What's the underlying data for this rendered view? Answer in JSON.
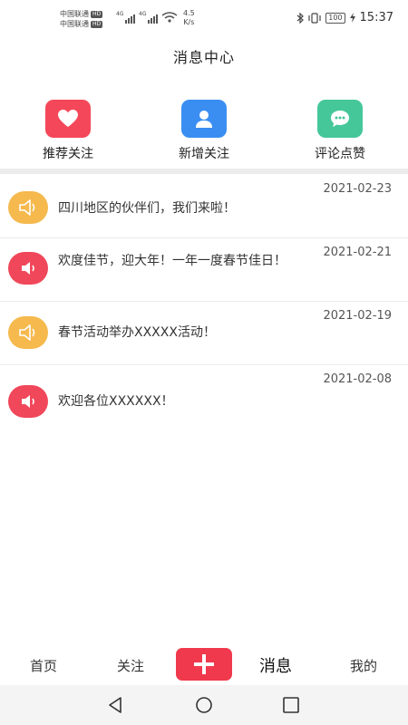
{
  "status_bar": {
    "carrier1": "中国联通",
    "carrier2": "中国联通",
    "hd1": "HD",
    "hd2": "HD",
    "net1": "4G",
    "net2": "4G",
    "speed_value": "4.5",
    "speed_unit": "K/s",
    "battery": "100",
    "time": "15:37"
  },
  "header": {
    "title": "消息中心"
  },
  "quick_actions": [
    {
      "label": "推荐关注",
      "icon": "heart-icon",
      "color": "#f5475a"
    },
    {
      "label": "新增关注",
      "icon": "user-icon",
      "color": "#3a8ef2"
    },
    {
      "label": "评论点赞",
      "icon": "chat-bubble-icon",
      "color": "#45c79a"
    }
  ],
  "messages": [
    {
      "date": "2021-02-23",
      "text": "四川地区的伙伴们，我们来啦！",
      "icon": "speaker-outline-icon",
      "color": "#f5b94d"
    },
    {
      "date": "2021-02-21",
      "text": "欢度佳节，迎大年！一年一度春节佳日！",
      "icon": "speaker-solid-icon",
      "color": "#f0475a"
    },
    {
      "date": "2021-02-19",
      "text": "春节活动举办XXXXX活动！",
      "icon": "speaker-outline-icon",
      "color": "#f5b94d"
    },
    {
      "date": "2021-02-08",
      "text": "欢迎各位XXXXXX！",
      "icon": "speaker-solid-icon",
      "color": "#f0475a"
    }
  ],
  "bottom_nav": {
    "home": "首页",
    "follow": "关注",
    "add_icon": "plus-icon",
    "messages": "消息",
    "mine": "我的",
    "active": "messages",
    "accent": "#f0394d"
  }
}
